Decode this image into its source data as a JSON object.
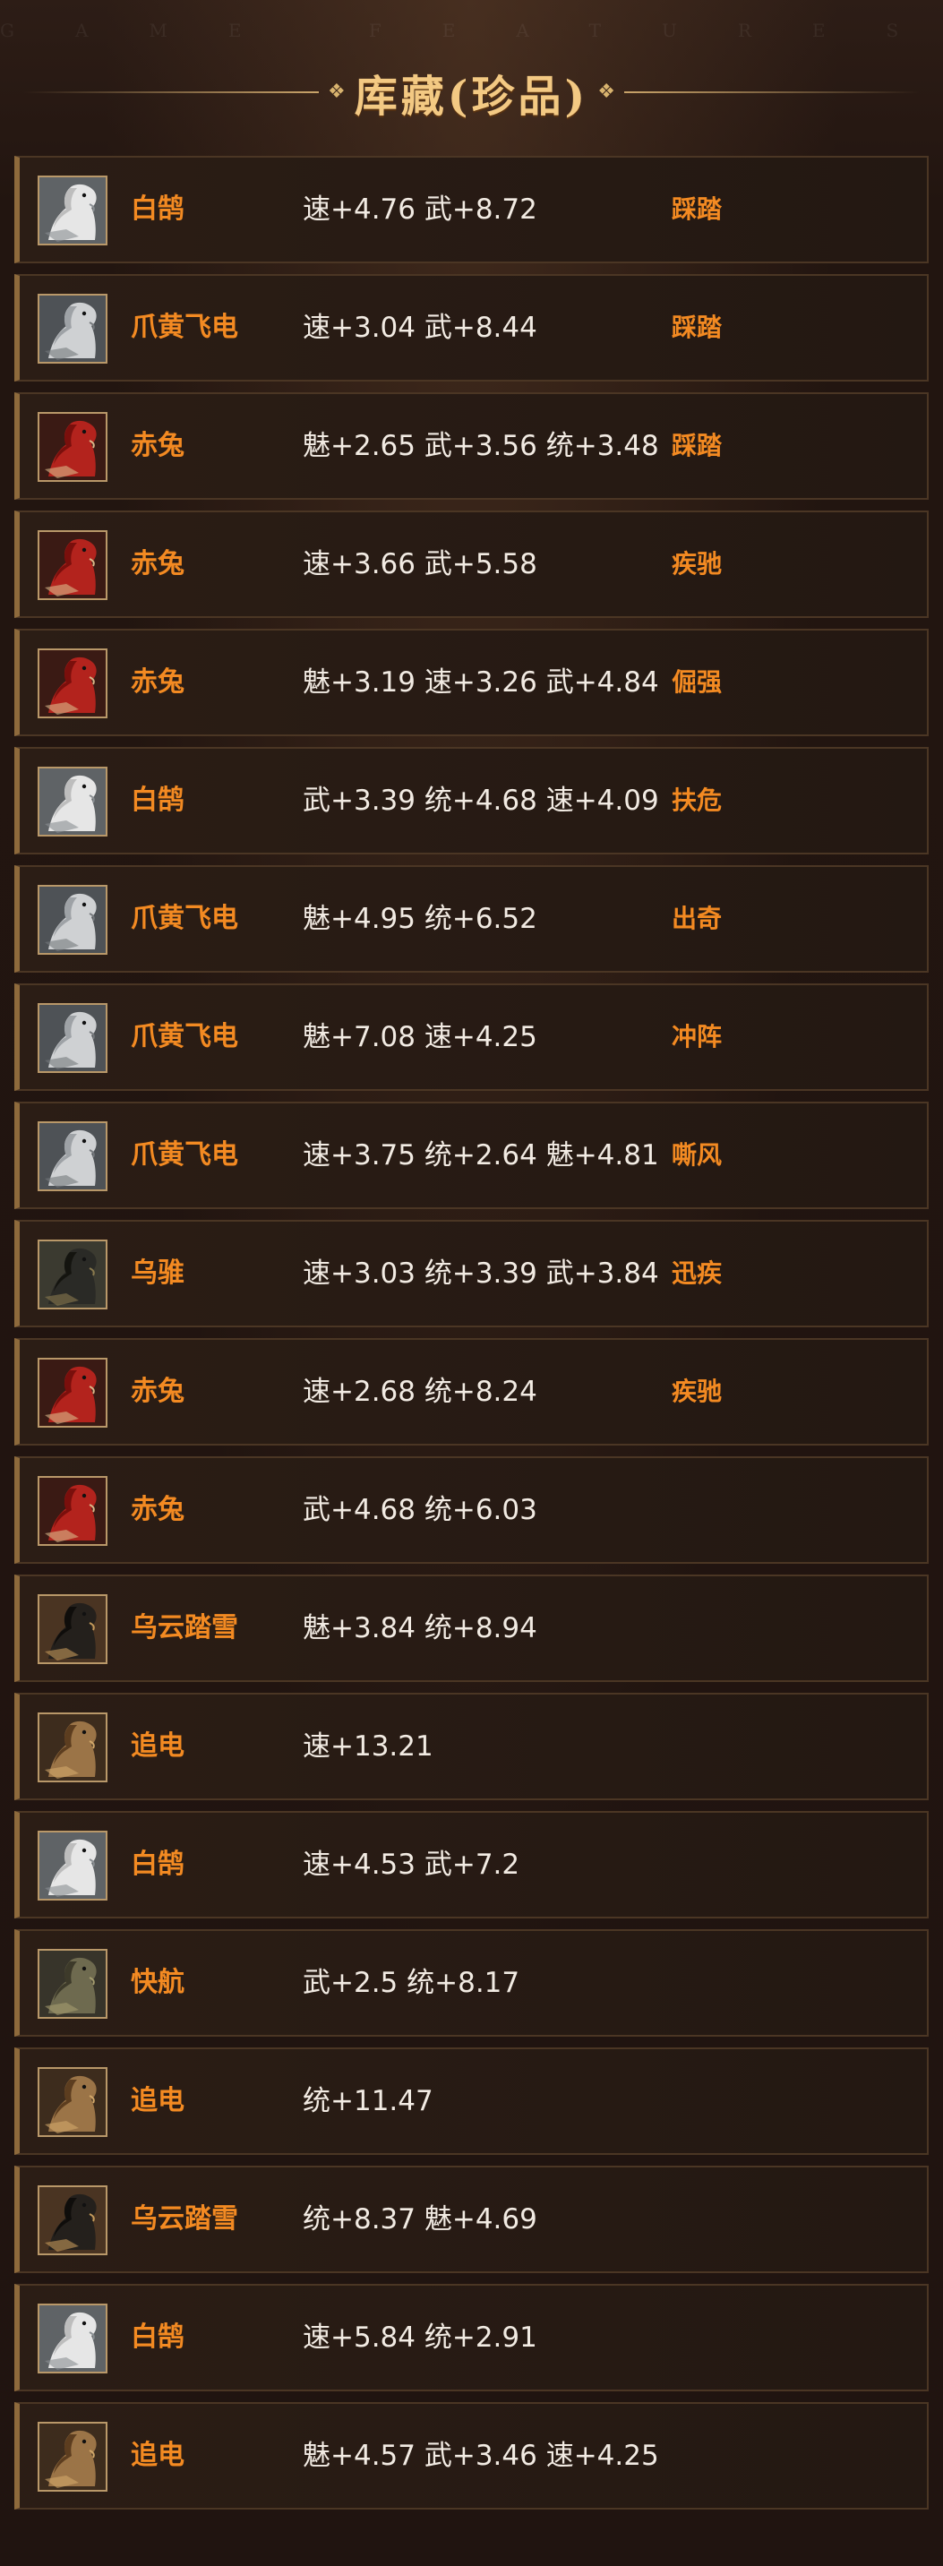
{
  "watermark": "GAME FEATURES",
  "title": "库藏(珍品)",
  "colors": {
    "accent_orange": "#f38a22",
    "title_gold": "#f3c983",
    "stat_text": "#f2ebe3",
    "row_border": "#4b3624",
    "row_left_accent": "#8e6a3c"
  },
  "items": [
    {
      "name": "白鹄",
      "stats": "速+4.76 武+8.72",
      "skill": "踩踏",
      "icon": "white-horse-icon"
    },
    {
      "name": "爪黄飞电",
      "stats": "速+3.04 武+8.44",
      "skill": "踩踏",
      "icon": "gray-horse-icon"
    },
    {
      "name": "赤兔",
      "stats": "魅+2.65 武+3.56 统+3.48",
      "skill": "踩踏",
      "icon": "red-horse-icon"
    },
    {
      "name": "赤兔",
      "stats": "速+3.66 武+5.58",
      "skill": "疾驰",
      "icon": "red-horse-icon"
    },
    {
      "name": "赤兔",
      "stats": "魅+3.19 速+3.26 武+4.84",
      "skill": "倔强",
      "icon": "red-horse-icon"
    },
    {
      "name": "白鹄",
      "stats": "武+3.39 统+4.68 速+4.09",
      "skill": "扶危",
      "icon": "white-horse-icon"
    },
    {
      "name": "爪黄飞电",
      "stats": "魅+4.95 统+6.52",
      "skill": "出奇",
      "icon": "gray-horse-icon"
    },
    {
      "name": "爪黄飞电",
      "stats": "魅+7.08 速+4.25",
      "skill": "冲阵",
      "icon": "gray-horse-icon"
    },
    {
      "name": "爪黄飞电",
      "stats": "速+3.75 统+2.64 魅+4.81",
      "skill": "嘶风",
      "icon": "gray-horse-icon"
    },
    {
      "name": "乌骓",
      "stats": "速+3.03 统+3.39 武+3.84",
      "skill": "迅疾",
      "icon": "black-horse-icon"
    },
    {
      "name": "赤兔",
      "stats": "速+2.68 统+8.24",
      "skill": "疾驰",
      "icon": "red-horse-icon"
    },
    {
      "name": "赤兔",
      "stats": "武+4.68 统+6.03",
      "skill": "",
      "icon": "red-horse-icon"
    },
    {
      "name": "乌云踏雪",
      "stats": "魅+3.84 统+8.94",
      "skill": "",
      "icon": "dark-horse-icon"
    },
    {
      "name": "追电",
      "stats": "速+13.21",
      "skill": "",
      "icon": "brown-horse-icon"
    },
    {
      "name": "白鹄",
      "stats": "速+4.53 武+7.2",
      "skill": "",
      "icon": "white-horse-icon"
    },
    {
      "name": "快航",
      "stats": "武+2.5 统+8.17",
      "skill": "",
      "icon": "olive-horse-icon"
    },
    {
      "name": "追电",
      "stats": "统+11.47",
      "skill": "",
      "icon": "brown-horse-icon"
    },
    {
      "name": "乌云踏雪",
      "stats": "统+8.37 魅+4.69",
      "skill": "",
      "icon": "dark-horse-icon"
    },
    {
      "name": "白鹄",
      "stats": "速+5.84 统+2.91",
      "skill": "",
      "icon": "white-horse-icon"
    },
    {
      "name": "追电",
      "stats": "魅+4.57 武+3.46 速+4.25",
      "skill": "",
      "icon": "brown-horse-icon"
    }
  ]
}
